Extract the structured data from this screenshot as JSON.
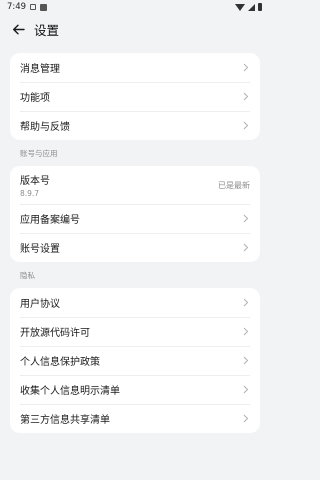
{
  "status_bar": {
    "time": "7:49"
  },
  "header": {
    "title": "设置"
  },
  "group1": {
    "items": [
      {
        "label": "消息管理"
      },
      {
        "label": "功能项"
      },
      {
        "label": "帮助与反馈"
      }
    ]
  },
  "account_section": {
    "title": "账号与应用",
    "version": {
      "label": "版本号",
      "number": "8.9.7",
      "status": "已是最新"
    },
    "items": [
      {
        "label": "应用备案编号"
      },
      {
        "label": "账号设置"
      }
    ]
  },
  "privacy_section": {
    "title": "隐私",
    "items": [
      {
        "label": "用户协议"
      },
      {
        "label": "开放源代码许可"
      },
      {
        "label": "个人信息保护政策"
      },
      {
        "label": "收集个人信息明示清单"
      },
      {
        "label": "第三方信息共享清单"
      }
    ]
  },
  "colors": {
    "background": "#f1f3f5",
    "card": "#ffffff",
    "secondary_text": "#8c8c8c"
  }
}
